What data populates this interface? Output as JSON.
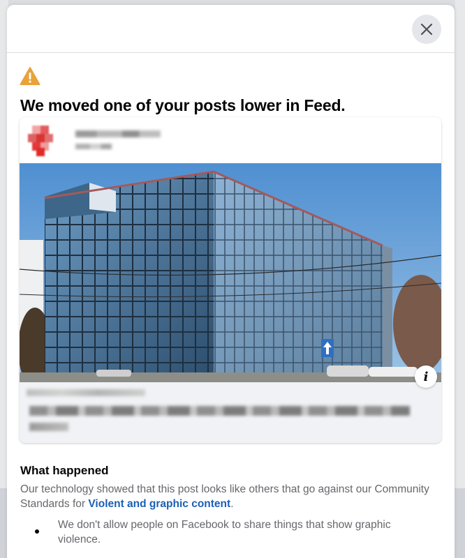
{
  "modal": {
    "close_icon": "close-icon",
    "warning_icon": "warning-triangle-icon",
    "headline": "We moved one of your posts lower in Feed.",
    "post": {
      "info_button_label": "i"
    },
    "what_happened": {
      "title": "What happened",
      "body_prefix": "Our technology showed that this post looks like others that go against our Community Standards for ",
      "link_text": "Violent and graphic content",
      "body_suffix": ".",
      "bullets": [
        "We don't allow people on Facebook to share things that show graphic violence."
      ]
    }
  },
  "colors": {
    "accent_link": "#1b5fb5",
    "warning": "#e9a23b",
    "text_primary": "#050505",
    "text_secondary": "#65676b"
  }
}
